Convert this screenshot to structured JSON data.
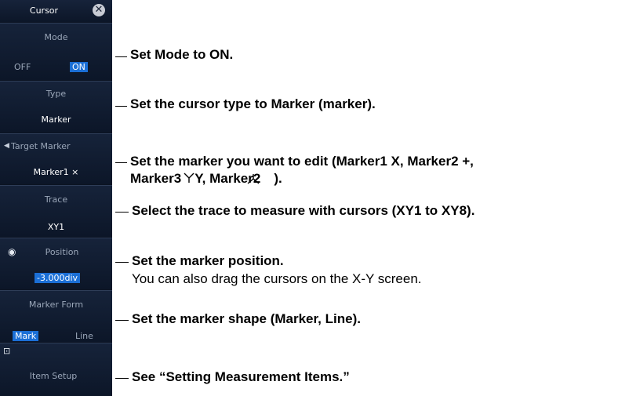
{
  "panel": {
    "title": "Cursor",
    "close_icon": "✕",
    "mode": {
      "label": "Mode",
      "off": "OFF",
      "on": "ON",
      "selected": "ON"
    },
    "type": {
      "label": "Type",
      "value": "Marker"
    },
    "target_marker": {
      "arrow": "◀",
      "label": "Target Marker",
      "value": "Marker1 ×"
    },
    "trace": {
      "label": "Trace",
      "value": "XY1"
    },
    "position": {
      "radio": "◉",
      "label": "Position",
      "value": "-3.000div"
    },
    "marker_form": {
      "label": "Marker Form",
      "options": [
        "Mark",
        "Line"
      ],
      "selected": "Mark"
    },
    "item_setup": {
      "icon": "⊡",
      "label": "Item Setup"
    }
  },
  "annotations": {
    "mode": "Set Mode to ON.",
    "type": "Set the cursor type to Marker (marker).",
    "target_line1": "Set the marker you want to edit (Marker1 X, Marker2 +,",
    "target_line2": "Marker3　Y, Marker2　).",
    "trace": "Select the trace to measure with cursors (XY1 to XY8).",
    "position_title": "Set the marker position.",
    "position_sub": "You can also drag the cursors on the X-Y screen.",
    "marker_form": "Set the marker shape (Marker, Line).",
    "item_setup": "See “Setting Measurement Items.”"
  }
}
